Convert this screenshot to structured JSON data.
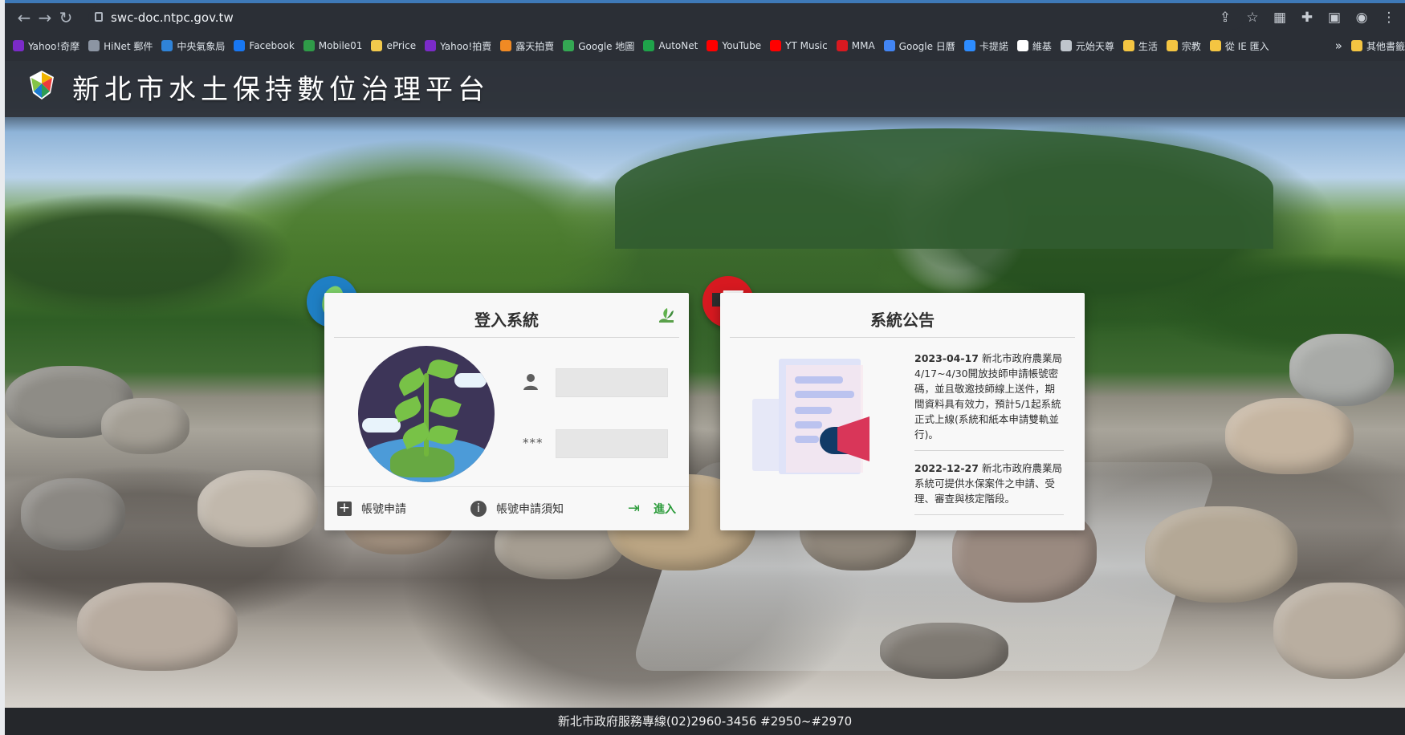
{
  "browser": {
    "url": "swc-doc.ntpc.gov.tw",
    "bookmarks": [
      {
        "label": "Yahoo!奇摩",
        "color": "#7b2bc8"
      },
      {
        "label": "HiNet 郵件",
        "color": "#8c95a3"
      },
      {
        "label": "中央氣象局",
        "color": "#2f83d8"
      },
      {
        "label": "Facebook",
        "color": "#1877f2"
      },
      {
        "label": "Mobile01",
        "color": "#2f9b48"
      },
      {
        "label": "ePrice",
        "color": "#f2c94c"
      },
      {
        "label": "Yahoo!拍賣",
        "color": "#7b2bc8"
      },
      {
        "label": "露天拍賣",
        "color": "#f08a24"
      },
      {
        "label": "Google 地圖",
        "color": "#34a853"
      },
      {
        "label": "AutoNet",
        "color": "#1fa34a"
      },
      {
        "label": "YouTube",
        "color": "#ff0000"
      },
      {
        "label": "YT Music",
        "color": "#ff0000"
      },
      {
        "label": "MMA",
        "color": "#d71920"
      },
      {
        "label": "Google 日曆",
        "color": "#4285f4"
      },
      {
        "label": "卡提諾",
        "color": "#2d8cff"
      },
      {
        "label": "維基",
        "color": "#ffffff"
      },
      {
        "label": "元始天尊",
        "color": "#bfc5cc"
      },
      {
        "label": "生活",
        "color": "#f4c542"
      },
      {
        "label": "宗教",
        "color": "#f4c542"
      },
      {
        "label": "從 IE 匯入",
        "color": "#f4c542"
      }
    ],
    "more_label": "»",
    "other_bookmarks": "其他書籤"
  },
  "header": {
    "title": "新北市水土保持數位治理平台"
  },
  "login": {
    "title": "登入系統",
    "username_value": "",
    "password_value": "",
    "password_icon": "***",
    "apply_label": "帳號申請",
    "notice_label": "帳號申請須知",
    "enter_label": "進入"
  },
  "announcements": {
    "title": "系統公告",
    "items": [
      {
        "date": "2023-04-17",
        "text": "新北市政府農業局 4/17~4/30開放技師申請帳號密碼，並且敬邀技師線上送件，期間資料具有效力，預計5/1起系統正式上線(系統和紙本申請雙軌並行)。"
      },
      {
        "date": "2022-12-27",
        "text": "新北市政府農業局 系統可提供水保案件之申請、受理、審查與核定階段。"
      }
    ]
  },
  "footer": {
    "text": "新北市政府服務專線(02)2960-3456 #2950~#2970"
  }
}
